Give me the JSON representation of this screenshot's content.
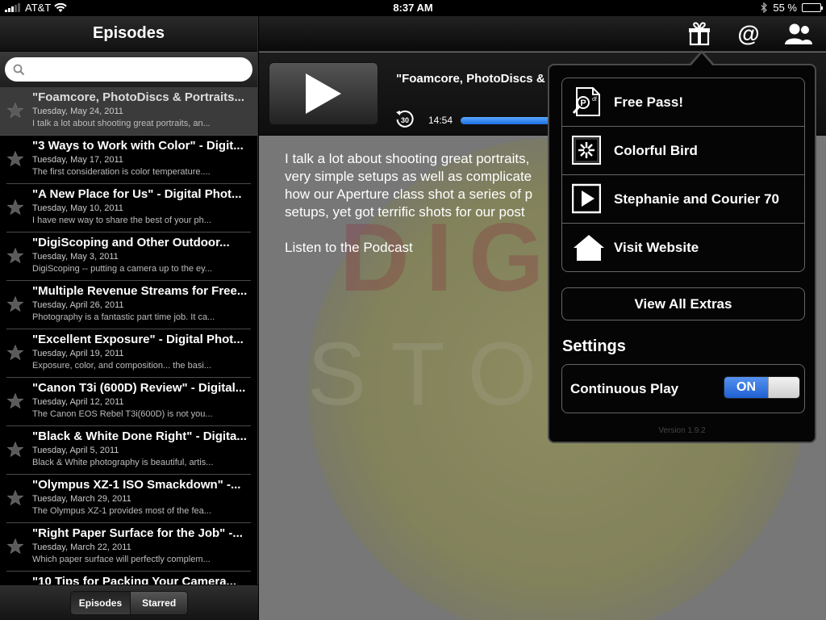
{
  "status_bar": {
    "carrier": "AT&T",
    "time": "8:37 AM",
    "battery": "55 %",
    "battery_level": 0.55
  },
  "sidebar": {
    "title": "Episodes",
    "search": {
      "value": "",
      "placeholder": ""
    },
    "episodes": [
      {
        "title": "\"Foamcore, PhotoDiscs & Portraits...",
        "date": "Tuesday, May 24, 2011",
        "desc": "I talk a lot about shooting great portraits, an..."
      },
      {
        "title": "\"3 Ways to Work with Color\" - Digit...",
        "date": "Tuesday, May 17, 2011",
        "desc": "The first consideration is color temperature...."
      },
      {
        "title": "\"A New Place for Us\" - Digital Phot...",
        "date": "Tuesday, May 10, 2011",
        "desc": "I have new way to share the best of your ph..."
      },
      {
        "title": "\"DigiScoping and Other Outdoor...",
        "date": "Tuesday, May 3, 2011",
        "desc": "DigiScoping -- putting a camera up to the ey..."
      },
      {
        "title": "\"Multiple Revenue Streams for Free...",
        "date": "Tuesday, April 26, 2011",
        "desc": "Photography is a fantastic part time job. It ca..."
      },
      {
        "title": "\"Excellent Exposure\" - Digital Phot...",
        "date": "Tuesday, April 19, 2011",
        "desc": "Exposure, color, and composition... the basi..."
      },
      {
        "title": "\"Canon T3i (600D) Review\" - Digital...",
        "date": "Tuesday, April 12, 2011",
        "desc": "The Canon EOS Rebel T3i(600D) is not you..."
      },
      {
        "title": "\"Black & White Done Right\" - Digita...",
        "date": "Tuesday, April 5, 2011",
        "desc": "Black & White photography is beautiful, artis..."
      },
      {
        "title": "\"Olympus XZ-1 ISO Smackdown\" -...",
        "date": "Tuesday, March 29, 2011",
        "desc": "The Olympus XZ-1 provides most of the fea..."
      },
      {
        "title": "\"Right Paper Surface for the Job\" -...",
        "date": "Tuesday, March 22, 2011",
        "desc": "Which paper surface will perfectly complem..."
      },
      {
        "title": "\"10 Tips for Packing Your Camera...",
        "date": "",
        "desc": ""
      }
    ],
    "tabs": {
      "episodes": "Episodes",
      "starred": "Starred"
    }
  },
  "player": {
    "title": "\"Foamcore, PhotoDiscs &",
    "skip_seconds": "30",
    "elapsed": "14:54",
    "progress": 0.45
  },
  "description": {
    "text": "I talk a lot about shooting great portraits, very simple setups as well as complicate how our Aperture class shot a series of p setups, yet got terrific shots for our post",
    "link": "Listen to the Podcast"
  },
  "background_art": {
    "text1": "DIGI",
    "text2": "STO"
  },
  "popover": {
    "extras": [
      {
        "label": "Free Pass!",
        "icon": "pdf-icon"
      },
      {
        "label": "Colorful Bird",
        "icon": "image-icon"
      },
      {
        "label": "Stephanie and Courier 70",
        "icon": "video-icon"
      },
      {
        "label": "Visit Website",
        "icon": "home-icon"
      }
    ],
    "view_all": "View All Extras",
    "settings_title": "Settings",
    "continuous_play": {
      "label": "Continuous Play",
      "state": "ON"
    },
    "version": "Version 1.9.2"
  },
  "toolbar_icons": [
    "gift-icon",
    "at-icon",
    "contacts-icon"
  ],
  "colors": {
    "accent_blue": "#1f5fd1",
    "progress_blue": "#3a8cf0"
  }
}
